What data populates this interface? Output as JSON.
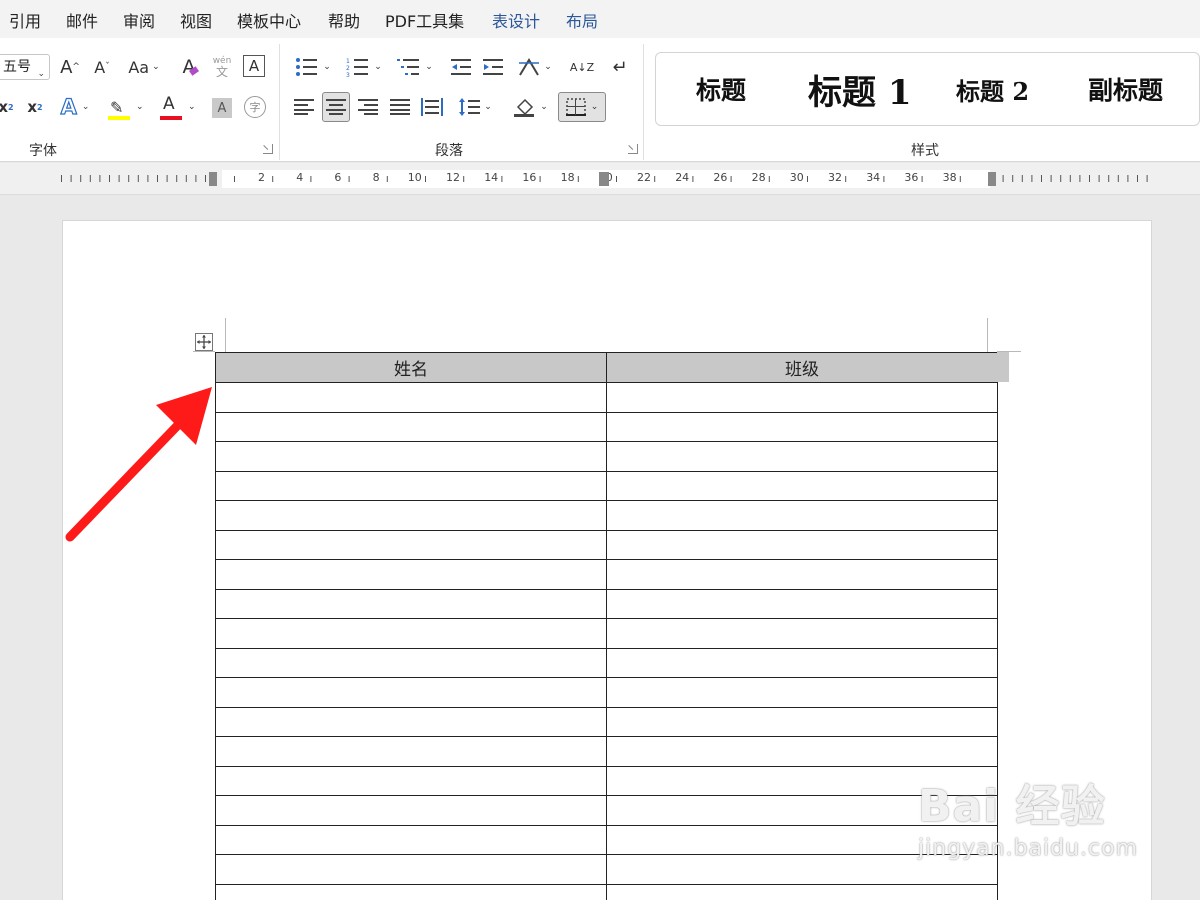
{
  "menu": {
    "tabs": [
      {
        "label": "引用"
      },
      {
        "label": "邮件"
      },
      {
        "label": "审阅"
      },
      {
        "label": "视图"
      },
      {
        "label": "模板中心"
      },
      {
        "label": "帮助"
      },
      {
        "label": "PDF工具集"
      },
      {
        "label": "表设计"
      },
      {
        "label": "布局"
      }
    ]
  },
  "ribbon": {
    "font": {
      "group_label": "字体",
      "font_size": "五号",
      "grow_label": "A",
      "shrink_label": "A",
      "case_label": "Aa",
      "clear_format_label": "A",
      "phonetic_top": "wén",
      "phonetic_bottom": "文",
      "char_border_label": "A",
      "subscript_label": "x",
      "superscript_label": "x",
      "text_effect_label": "A",
      "font_color_label": "A",
      "char_shading_label": "A",
      "enclose_char_label": "字",
      "highlight_color": "#ffff00",
      "font_color": "#e81123"
    },
    "paragraph": {
      "group_label": "段落",
      "sort_label": "A↓Z"
    },
    "styles": {
      "group_label": "样式",
      "items": [
        {
          "label": "标题"
        },
        {
          "label": "标题 1"
        },
        {
          "label": "标题 2"
        },
        {
          "label": "副标题"
        }
      ]
    }
  },
  "ruler": {
    "numbers": [
      "2",
      "4",
      "6",
      "8",
      "10",
      "12",
      "14",
      "16",
      "18",
      "20",
      "22",
      "24",
      "26",
      "28",
      "30",
      "32",
      "34",
      "36",
      "38"
    ]
  },
  "table": {
    "headers": [
      "姓名",
      "班级"
    ],
    "empty_rows": 18
  },
  "annotation": {
    "arrow_color": "#ff1a1a"
  },
  "watermark": {
    "line1": "Bai 经验",
    "line2": "jingyan.baidu.com"
  }
}
